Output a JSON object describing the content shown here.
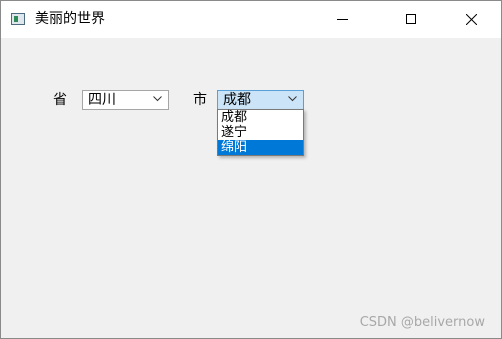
{
  "window": {
    "title": "美丽的世界",
    "icon": "app-window-icon",
    "controls": [
      "minimize-icon",
      "maximize-icon",
      "close-icon"
    ]
  },
  "form": {
    "province_label": "省",
    "province_value": "四川",
    "city_label": "市",
    "city_value": "成都"
  },
  "city_dropdown": {
    "open": true,
    "options": [
      "成都",
      "遂宁",
      "绵阳"
    ],
    "highlighted_index": 2
  },
  "watermark": "CSDN @belivernow",
  "colors": {
    "highlight": "#0078d7",
    "combo_focus_bg": "#cce4f7",
    "combo_focus_border": "#5aa0d8"
  }
}
